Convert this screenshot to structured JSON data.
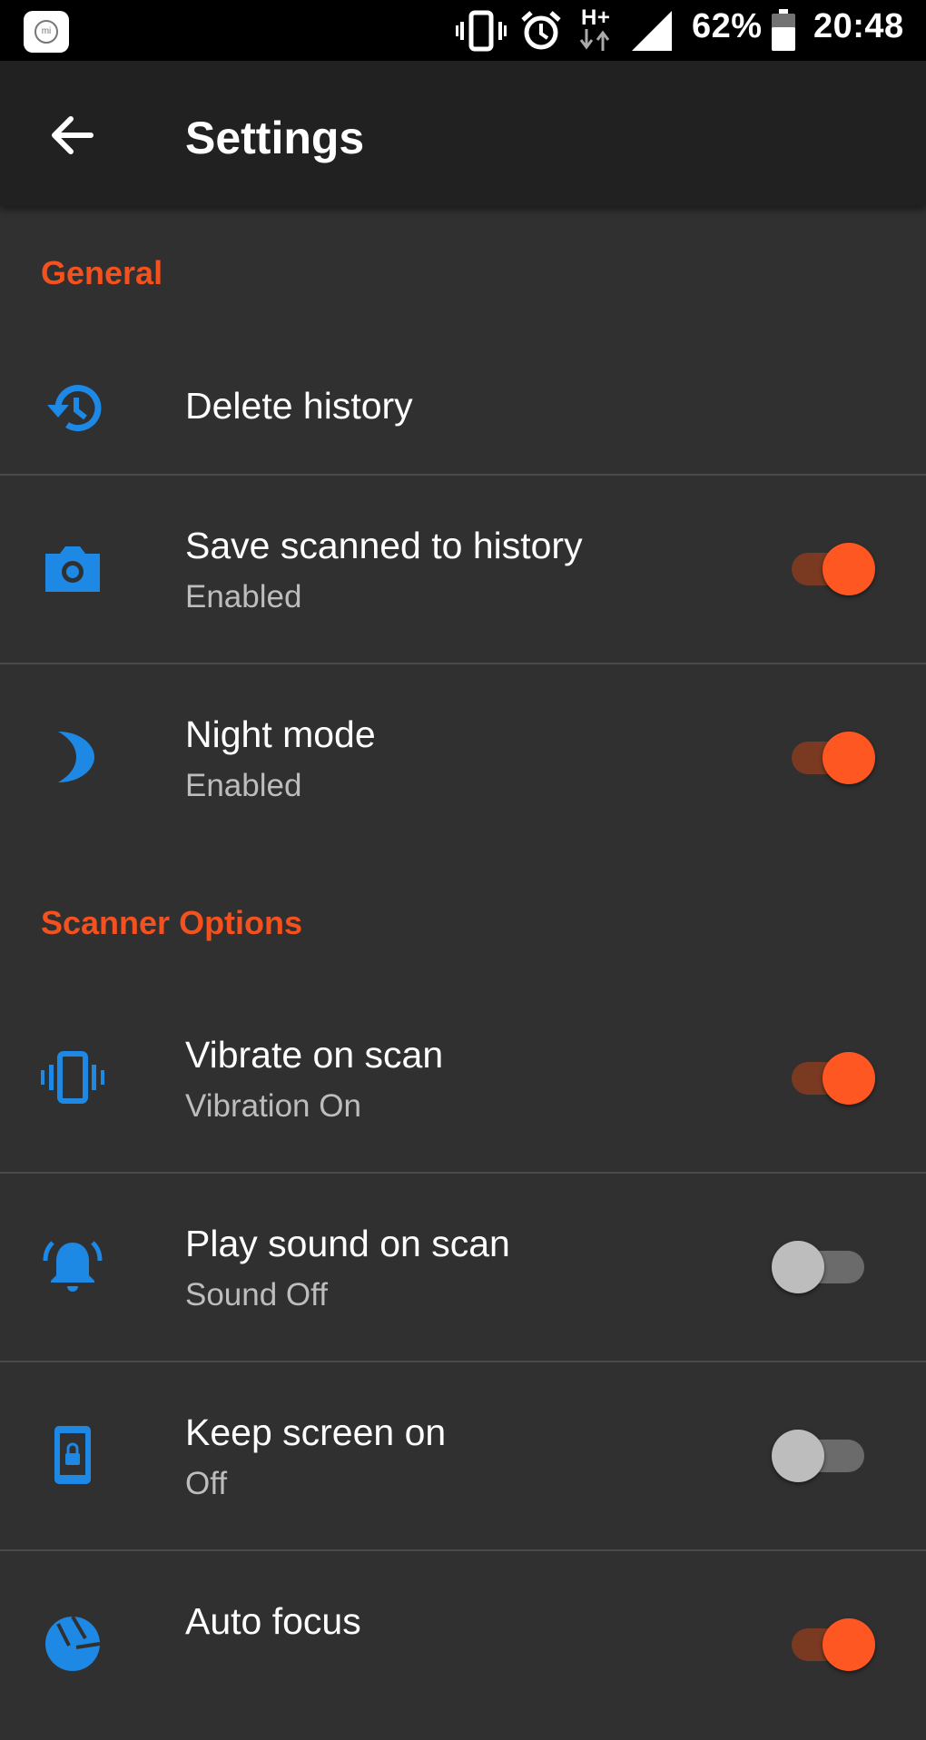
{
  "status_bar": {
    "battery": "62%",
    "time": "20:48",
    "network": "H+"
  },
  "app_bar": {
    "title": "Settings"
  },
  "sections": {
    "general": "General",
    "scanner": "Scanner Options"
  },
  "items": {
    "delete_history": {
      "title": "Delete history"
    },
    "save_scanned": {
      "title": "Save scanned to history",
      "summary": "Enabled",
      "checked": true
    },
    "night_mode": {
      "title": "Night mode",
      "summary": "Enabled",
      "checked": true
    },
    "vibrate": {
      "title": "Vibrate on scan",
      "summary": "Vibration On",
      "checked": true
    },
    "play_sound": {
      "title": "Play sound on scan",
      "summary": "Sound Off",
      "checked": false
    },
    "keep_screen": {
      "title": "Keep screen on",
      "summary": "Off",
      "checked": false
    },
    "auto_focus": {
      "title": "Auto focus",
      "checked": true
    }
  },
  "colors": {
    "accent": "#ff5722",
    "icon": "#1e88e5",
    "background": "#303030",
    "app_bar": "#212121"
  }
}
